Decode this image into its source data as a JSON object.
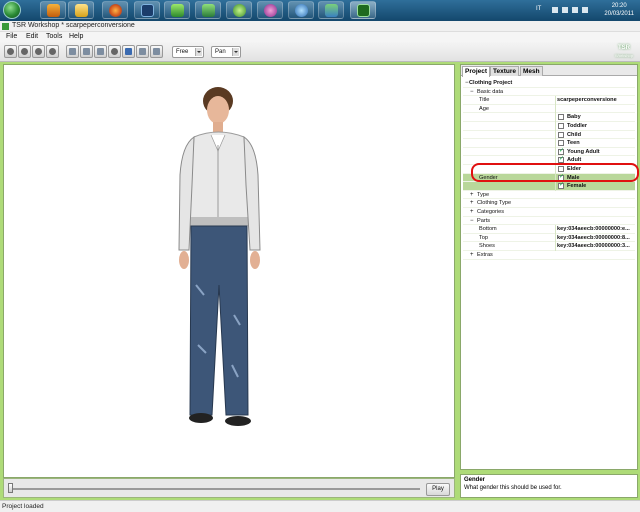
{
  "window": {
    "title": "TSR Workshop * scarpeperconversione"
  },
  "menu": [
    "File",
    "Edit",
    "Tools",
    "Help"
  ],
  "toolbar": {
    "mode_combo": "Free",
    "nav_combo": "Pan",
    "logo_text": "TSR",
    "logo_sub": "Workshop"
  },
  "tray": {
    "lang": "IT",
    "time": "20:20",
    "date": "20/03/2011"
  },
  "tabs": [
    "Project",
    "Texture",
    "Mesh"
  ],
  "tree": {
    "root": "Clothing Project",
    "basic_data": "Basic data",
    "title_label": "Title",
    "title_value": "scarpeperconversione",
    "age_label": "Age",
    "ages": [
      {
        "label": "Baby",
        "checked": false
      },
      {
        "label": "Toddler",
        "checked": false
      },
      {
        "label": "Child",
        "checked": false
      },
      {
        "label": "Teen",
        "checked": false
      },
      {
        "label": "Young Adult",
        "checked": true
      },
      {
        "label": "Adult",
        "checked": true
      },
      {
        "label": "Elder",
        "checked": false
      }
    ],
    "gender_label": "Gender",
    "genders": [
      {
        "label": "Male",
        "checked": true
      },
      {
        "label": "Female",
        "checked": true
      }
    ],
    "type": "Type",
    "clothing_type": "Clothing Type",
    "categories": "Categories",
    "parts": "Parts",
    "bottom_label": "Bottom",
    "bottom_value": "key:034aeecb:00000000:e...",
    "top_label": "Top",
    "top_value": "key:034aeecb:00000000:8...",
    "shoes_label": "Shoes",
    "shoes_value": "key:034aeecb:00000000:3...",
    "extras": "Extras"
  },
  "description": {
    "title": "Gender",
    "text": "What gender this should be used for."
  },
  "playback": {
    "play_label": "Play",
    "position": 0.0
  },
  "status": "Project loaded",
  "colors": {
    "workarea": "#aedb78",
    "highlight_ring": "#e01010"
  }
}
